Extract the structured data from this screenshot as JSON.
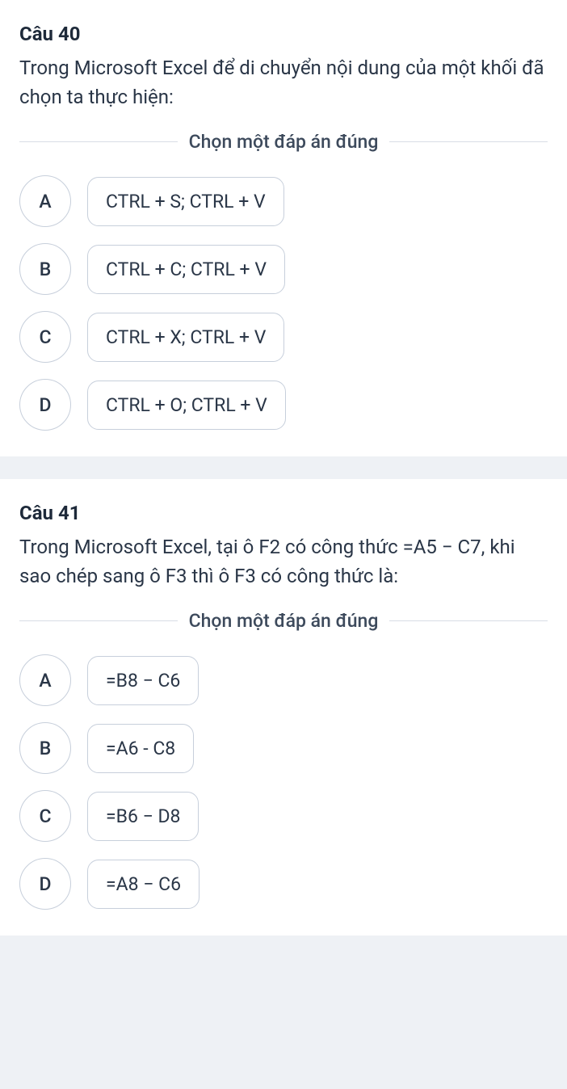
{
  "instruction": "Chọn một đáp án đúng",
  "questions": [
    {
      "title": "Câu 40",
      "text": "Trong Microsoft Excel để di chuyển nội dung của một khối đã chọn ta thực hiện:",
      "options": [
        {
          "letter": "A",
          "text": "CTRL + S; CTRL + V"
        },
        {
          "letter": "B",
          "text": "CTRL + C; CTRL + V"
        },
        {
          "letter": "C",
          "text": "CTRL + X; CTRL + V"
        },
        {
          "letter": "D",
          "text": "CTRL + O; CTRL + V"
        }
      ]
    },
    {
      "title": "Câu 41",
      "text": "Trong Microsoft Excel, tại ô F2 có công thức =A5 − C7, khi sao chép sang ô F3 thì ô F3 có công thức là:",
      "options": [
        {
          "letter": "A",
          "text": "=B8 − C6"
        },
        {
          "letter": "B",
          "text": "=A6 - C8"
        },
        {
          "letter": "C",
          "text": "=B6 − D8"
        },
        {
          "letter": "D",
          "text": "=A8 − C6"
        }
      ]
    }
  ]
}
